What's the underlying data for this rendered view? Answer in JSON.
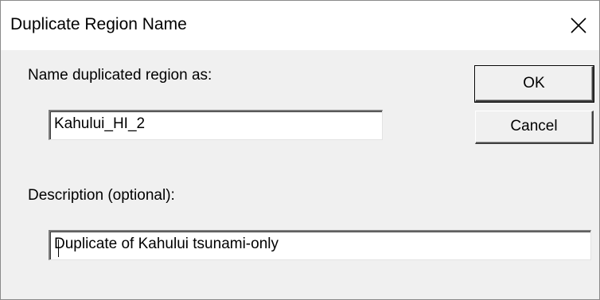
{
  "dialog": {
    "title": "Duplicate Region Name"
  },
  "icons": {
    "close": "close-icon"
  },
  "form": {
    "name_label": "Name duplicated region as:",
    "name_value": "Kahului_HI_2",
    "description_label": "Description (optional):",
    "description_value": "Duplicate of Kahului tsunami-only"
  },
  "buttons": {
    "ok_label": "OK",
    "cancel_label": "Cancel"
  },
  "colors": {
    "titlebar": "#ffffff",
    "dialog_background": "#f0f0f0",
    "field_background": "#ffffff"
  }
}
